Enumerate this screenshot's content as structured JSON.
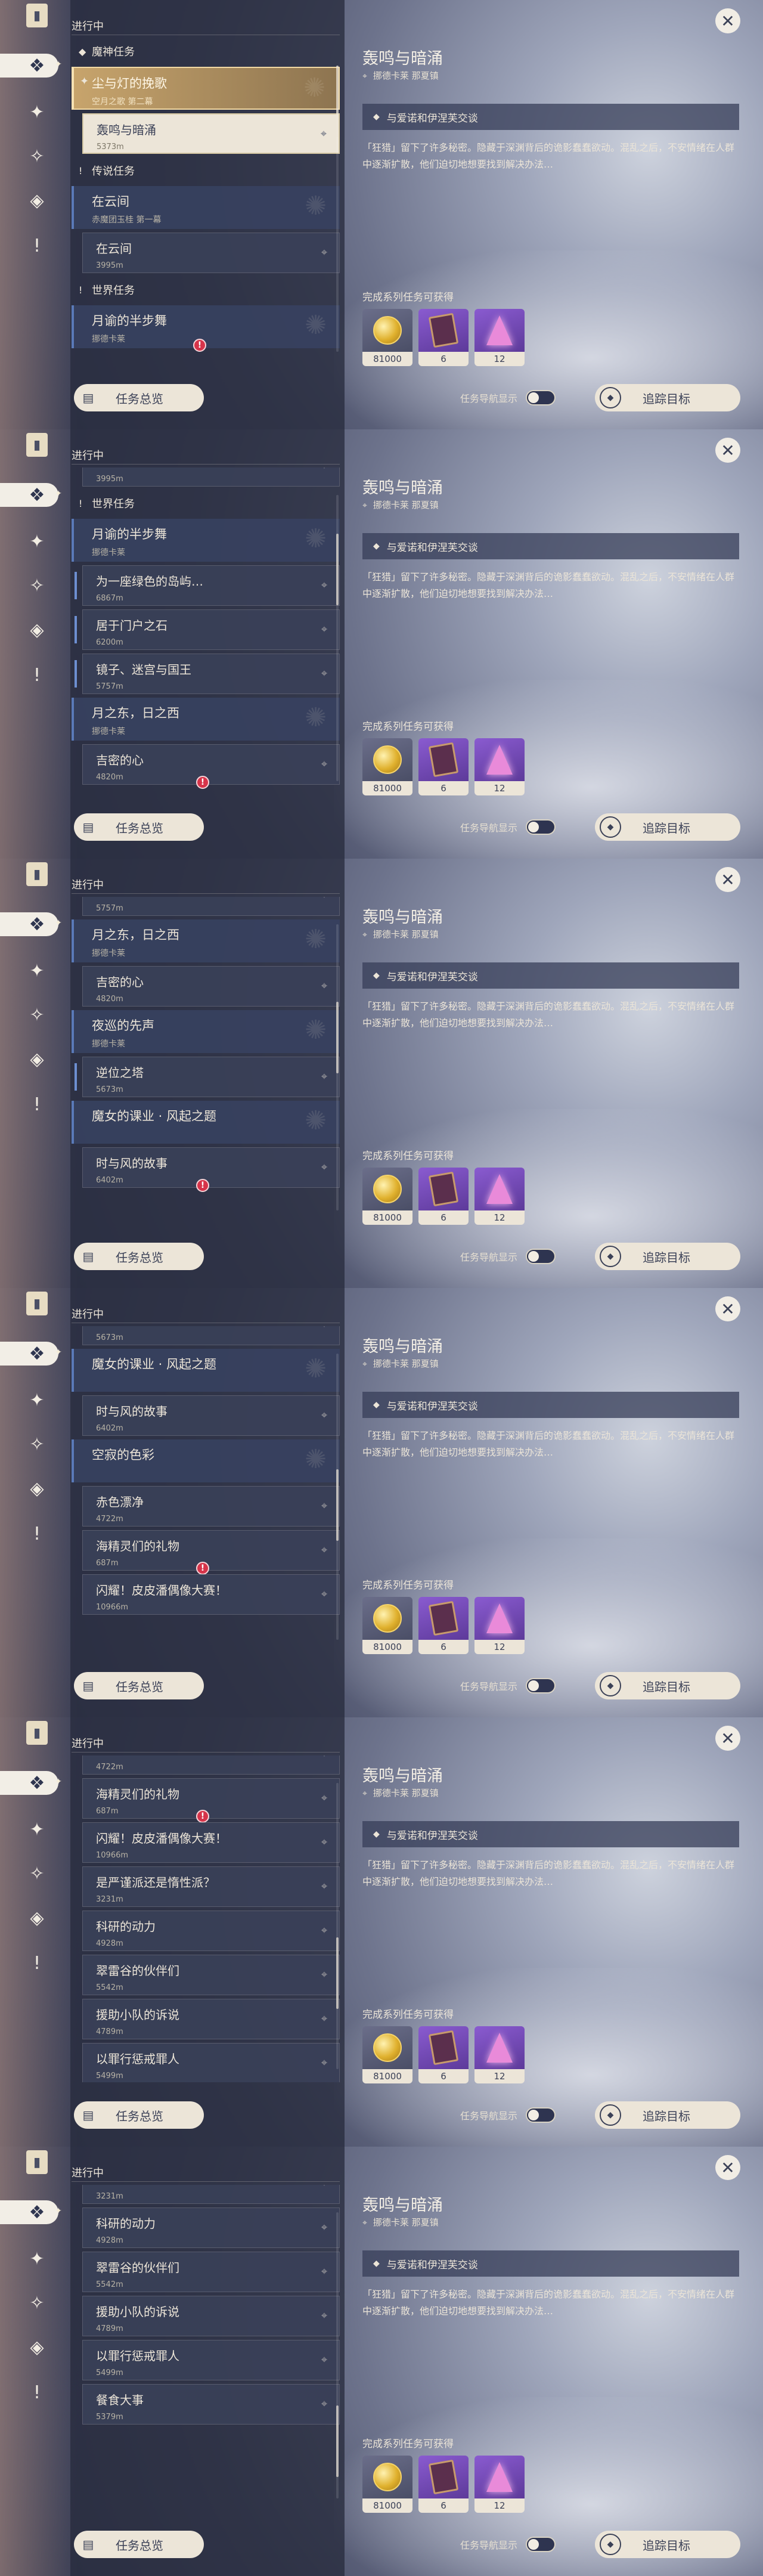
{
  "rail": {
    "top_icon": "quest-book-icon",
    "items": [
      {
        "icon": "all-quests-icon",
        "glyph": "❖"
      },
      {
        "icon": "archon-quest-icon",
        "glyph": "✦"
      },
      {
        "icon": "story-quest-icon",
        "glyph": "✧"
      },
      {
        "icon": "world-quest-icon",
        "glyph": "◈"
      },
      {
        "icon": "event-quest-icon",
        "glyph": "!"
      }
    ]
  },
  "list": {
    "progress_title": "进行中"
  },
  "footer": {
    "overview_label": "任务总览",
    "track_toggle_label": "任务导航显示",
    "track_button_label": "追踪目标"
  },
  "detail": {
    "title": "轰鸣与暗涌",
    "location": "挪德卡莱 那夏镇",
    "objective": "与爱诺和伊涅芙交谈",
    "description": "「狂猎」留下了许多秘密。隐藏于深渊背后的诡影蠢蠢欲动。混乱之后，不安情绪在人群中逐渐扩散，他们迫切地想要找到解决办法…",
    "rewards_title": "完成系列任务可获得",
    "rewards": [
      {
        "kind": "mora",
        "count": "81000"
      },
      {
        "kind": "exp-book",
        "count": "6"
      },
      {
        "kind": "enhancement-ore",
        "count": "12"
      }
    ]
  },
  "frames": [
    {
      "scroll": 0.0,
      "rows": [
        {
          "type": "header",
          "icon": "◆",
          "label": "魔神任务"
        },
        {
          "type": "parent",
          "title": "尘与灯的挽歌",
          "sub": "空月之歌 第二幕",
          "selected": true
        },
        {
          "type": "child",
          "title": "轰鸣与暗涌",
          "sub": "5373m",
          "selected": true
        },
        {
          "type": "header",
          "icon": "!",
          "label": "传说任务"
        },
        {
          "type": "parent",
          "title": "在云间",
          "sub": "赤魔团玉桂 第一幕"
        },
        {
          "type": "child",
          "title": "在云间",
          "sub": "3995m"
        },
        {
          "type": "header",
          "icon": "!",
          "label": "世界任务"
        },
        {
          "type": "parent",
          "title": "月谕的半步舞",
          "sub": "挪德卡莱",
          "badge": true
        }
      ]
    },
    {
      "scroll": 0.18,
      "rows": [
        {
          "type": "child",
          "title": "在云间",
          "sub": "3995m",
          "cut": true
        },
        {
          "type": "header",
          "icon": "!",
          "label": "世界任务"
        },
        {
          "type": "parent",
          "title": "月谕的半步舞",
          "sub": "挪德卡莱"
        },
        {
          "type": "child",
          "title": "为一座绿色的岛屿…",
          "sub": "6867m",
          "current": true
        },
        {
          "type": "child",
          "title": "居于门户之石",
          "sub": "6200m",
          "current": true
        },
        {
          "type": "child",
          "title": "镜子、迷宫与国王",
          "sub": "5757m",
          "current": true
        },
        {
          "type": "parent",
          "title": "月之东，日之西",
          "sub": "挪德卡莱"
        },
        {
          "type": "child",
          "title": "吉密的心",
          "sub": "4820m",
          "badge": true
        }
      ]
    },
    {
      "scroll": 0.36,
      "rows": [
        {
          "type": "child",
          "title": "镜子、迷宫与国王",
          "sub": "5757m",
          "cut": true
        },
        {
          "type": "parent",
          "title": "月之东，日之西",
          "sub": "挪德卡莱"
        },
        {
          "type": "child",
          "title": "吉密的心",
          "sub": "4820m"
        },
        {
          "type": "parent",
          "title": "夜巡的先声",
          "sub": "挪德卡莱"
        },
        {
          "type": "child",
          "title": "逆位之塔",
          "sub": "5673m",
          "current": true
        },
        {
          "type": "parent",
          "title": "魔女的课业 · 风起之题",
          "sub": ""
        },
        {
          "type": "child",
          "title": "时与风的故事",
          "sub": "6402m",
          "badge": true
        }
      ]
    },
    {
      "scroll": 0.54,
      "rows": [
        {
          "type": "child",
          "title": "逆位之塔",
          "sub": "5673m",
          "cut": true
        },
        {
          "type": "parent",
          "title": "魔女的课业 · 风起之题",
          "sub": ""
        },
        {
          "type": "child",
          "title": "时与风的故事",
          "sub": "6402m"
        },
        {
          "type": "parent",
          "title": "空寂的色彩",
          "sub": ""
        },
        {
          "type": "child",
          "title": "赤色漂净",
          "sub": "4722m"
        },
        {
          "type": "child",
          "title": "海精灵们的礼物",
          "sub": "687m",
          "badge": true
        },
        {
          "type": "child",
          "title": "闪耀！皮皮潘偶像大赛！",
          "sub": "10966m"
        }
      ]
    },
    {
      "scroll": 0.72,
      "rows": [
        {
          "type": "child",
          "title": "赤色漂净",
          "sub": "4722m",
          "cut": true
        },
        {
          "type": "child",
          "title": "海精灵们的礼物",
          "sub": "687m",
          "badge": true
        },
        {
          "type": "child",
          "title": "闪耀！皮皮潘偶像大赛！",
          "sub": "10966m"
        },
        {
          "type": "child",
          "title": "是严谨派还是惰性派？",
          "sub": "3231m"
        },
        {
          "type": "child",
          "title": "科研的动力",
          "sub": "4928m"
        },
        {
          "type": "child",
          "title": "翠雷谷的伙伴们",
          "sub": "5542m"
        },
        {
          "type": "child",
          "title": "援助小队的诉说",
          "sub": "4789m"
        },
        {
          "type": "child",
          "title": "以罪行惩戒罪人",
          "sub": "5499m"
        }
      ]
    },
    {
      "scroll": 0.9,
      "rows": [
        {
          "type": "child",
          "title": "是严谨派还是惰性派？",
          "sub": "3231m",
          "cut": true,
          "badge": true
        },
        {
          "type": "child",
          "title": "科研的动力",
          "sub": "4928m"
        },
        {
          "type": "child",
          "title": "翠雷谷的伙伴们",
          "sub": "5542m"
        },
        {
          "type": "child",
          "title": "援助小队的诉说",
          "sub": "4789m"
        },
        {
          "type": "child",
          "title": "以罪行惩戒罪人",
          "sub": "5499m"
        },
        {
          "type": "child",
          "title": "餐食大事",
          "sub": "5379m"
        }
      ]
    }
  ]
}
